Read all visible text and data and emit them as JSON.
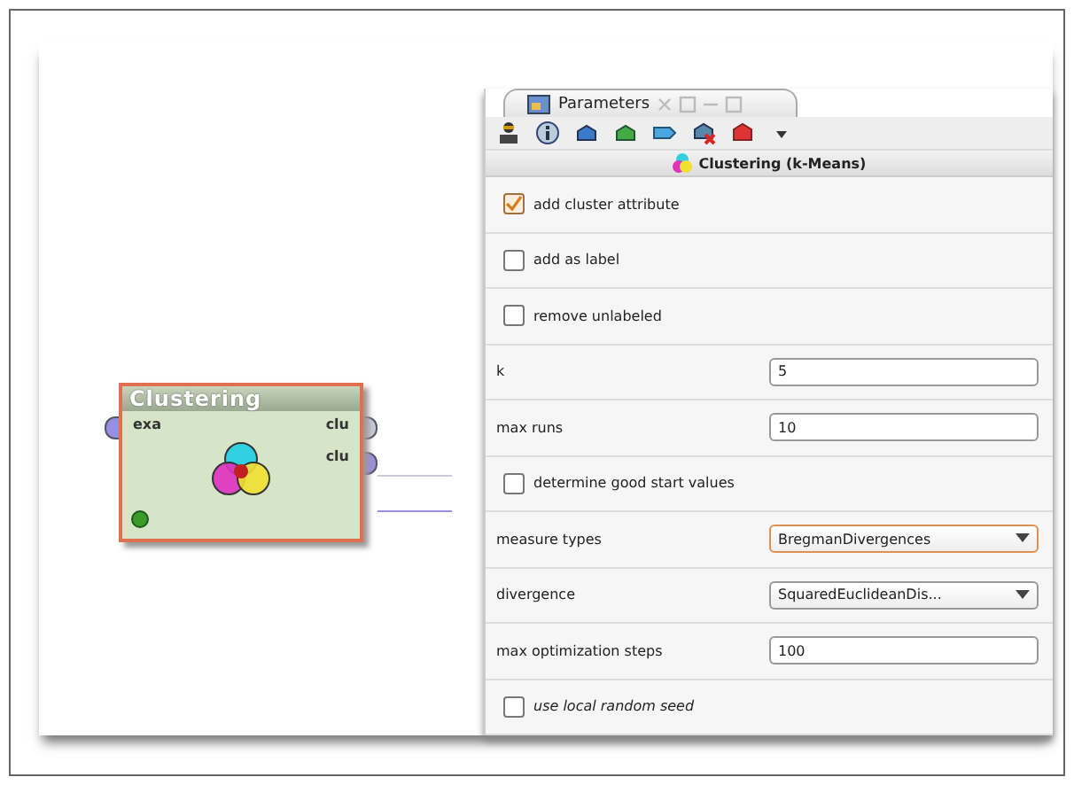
{
  "canvas": {
    "operator": {
      "title": "Clustering",
      "inputs": [
        {
          "label": "exa",
          "color": "#9a8ee0"
        }
      ],
      "outputs": [
        {
          "label": "clu",
          "color": "#c8c8d8"
        },
        {
          "label": "clu",
          "color": "#9a8ee0"
        }
      ]
    }
  },
  "panel": {
    "tab": {
      "label": "Parameters"
    },
    "title": "Clustering (k-Means)",
    "parameters": [
      {
        "kind": "checkbox",
        "label": "add cluster attribute",
        "checked": true,
        "italic": false
      },
      {
        "kind": "checkbox",
        "label": "add as label",
        "checked": false,
        "italic": false
      },
      {
        "kind": "checkbox",
        "label": "remove unlabeled",
        "checked": false,
        "italic": false
      },
      {
        "kind": "text",
        "label": "k",
        "value": "5"
      },
      {
        "kind": "text",
        "label": "max runs",
        "value": "10"
      },
      {
        "kind": "checkbox",
        "label": "determine good start values",
        "checked": false,
        "italic": false
      },
      {
        "kind": "select",
        "label": "measure types",
        "value": "BregmanDivergences",
        "focused": true
      },
      {
        "kind": "select",
        "label": "divergence",
        "value": "SquaredEuclideanDis...",
        "focused": false
      },
      {
        "kind": "text",
        "label": "max optimization steps",
        "value": "100"
      },
      {
        "kind": "checkbox",
        "label": "use local random seed",
        "checked": false,
        "italic": true
      }
    ]
  }
}
